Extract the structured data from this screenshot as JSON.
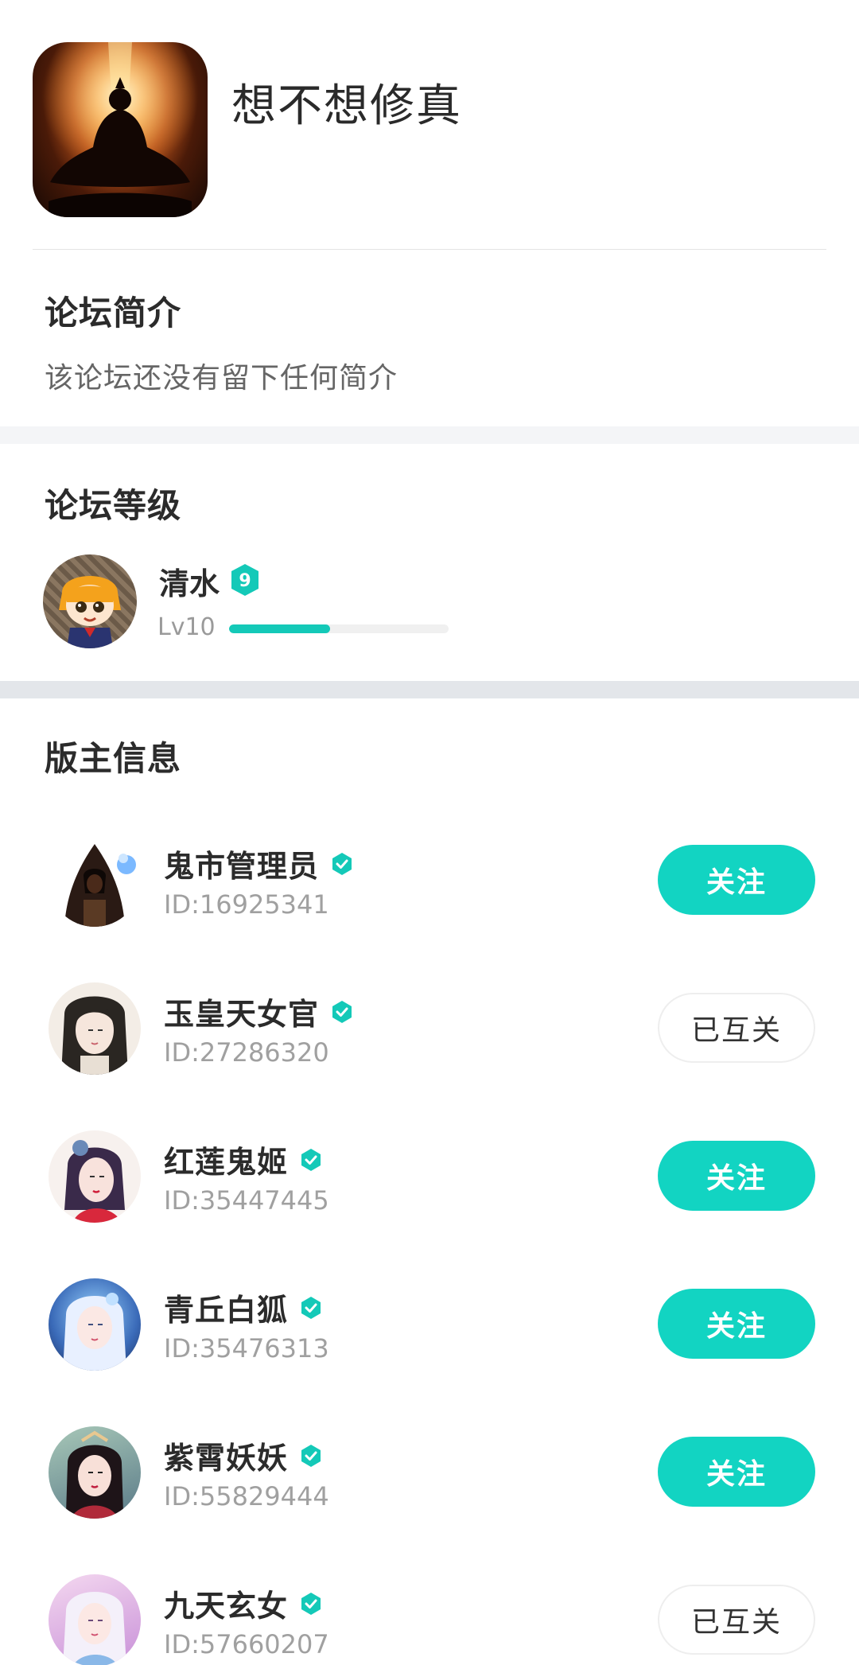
{
  "forum": {
    "name": "想不想修真",
    "icon": "meditating-cultivator-icon"
  },
  "intro": {
    "title": "论坛简介",
    "text": "该论坛还没有留下任何简介"
  },
  "level": {
    "title": "论坛等级",
    "user_name": "清水",
    "badge_value": "9",
    "level_text": "Lv10",
    "progress_fraction": 0.46,
    "accent_color": "#14c9b8"
  },
  "moderators": {
    "title": "版主信息",
    "items": [
      {
        "name": "鬼市管理员",
        "id": "ID:16925341",
        "button": "关注",
        "state": "follow",
        "avatar": "hooded-mage-avatar"
      },
      {
        "name": "玉皇天女官",
        "id": "ID:27286320",
        "button": "已互关",
        "state": "mutual",
        "avatar": "ink-lady-avatar"
      },
      {
        "name": "红莲鬼姬",
        "id": "ID:35447445",
        "button": "关注",
        "state": "follow",
        "avatar": "red-lotus-lady-avatar"
      },
      {
        "name": "青丘白狐",
        "id": "ID:35476313",
        "button": "关注",
        "state": "follow",
        "avatar": "white-fox-lady-avatar"
      },
      {
        "name": "紫霄妖妖",
        "id": "ID:55829444",
        "button": "关注",
        "state": "follow",
        "avatar": "purple-lady-avatar"
      },
      {
        "name": "九天玄女",
        "id": "ID:57660207",
        "button": "已互关",
        "state": "mutual",
        "avatar": "celestial-lady-avatar"
      }
    ]
  },
  "colors": {
    "accent": "#12d4c2",
    "verified": "#14c9b8"
  }
}
